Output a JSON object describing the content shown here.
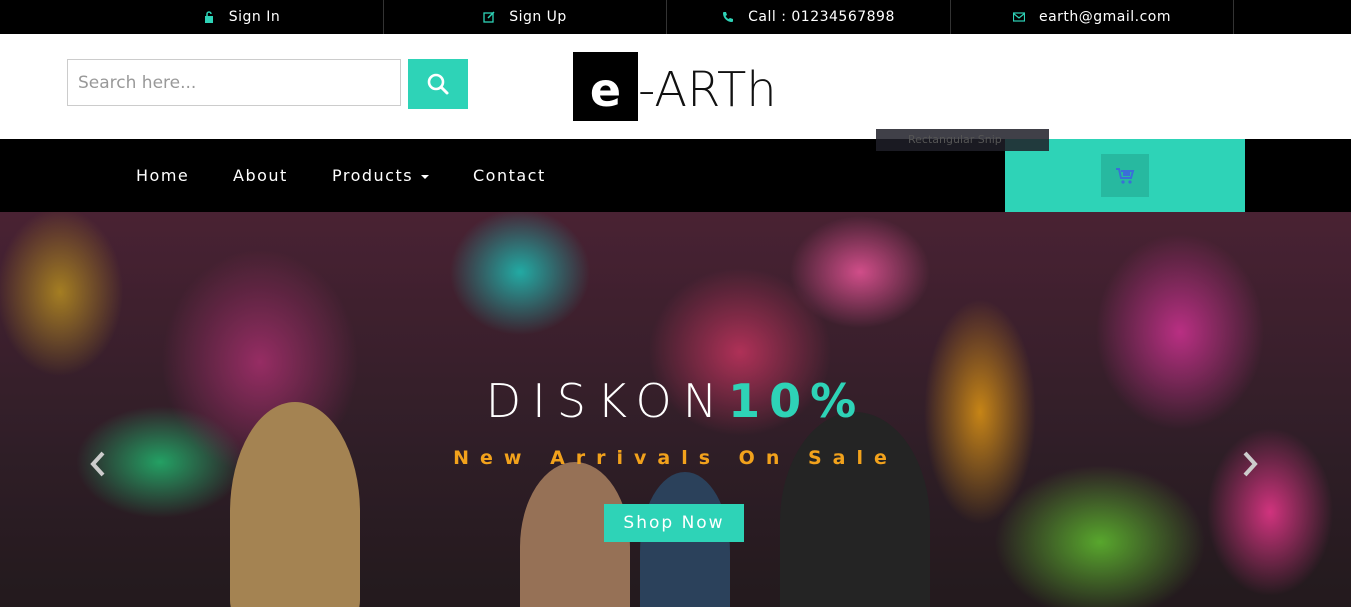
{
  "topbar": {
    "items": [
      {
        "icon": "lock-icon",
        "label": "Sign In"
      },
      {
        "icon": "edit-icon",
        "label": "Sign Up"
      },
      {
        "icon": "phone-icon",
        "label": "Call : 01234567898"
      },
      {
        "icon": "envelope-icon",
        "label": "earth@gmail.com"
      }
    ]
  },
  "header": {
    "search_placeholder": "Search here...",
    "logo_box": "e",
    "logo_text": "-ARTh",
    "tooltip": "Rectangular Snip"
  },
  "nav": {
    "items": [
      "Home",
      "About",
      "Products",
      "Contact"
    ]
  },
  "hero": {
    "title_main": "DISKON",
    "title_highlight": "10%",
    "subtitle": "New Arrivals On Sale",
    "button": "Shop Now"
  },
  "colors": {
    "accent": "#2ed3b7",
    "subtitle": "#f2a21c",
    "bar": "#000000"
  }
}
